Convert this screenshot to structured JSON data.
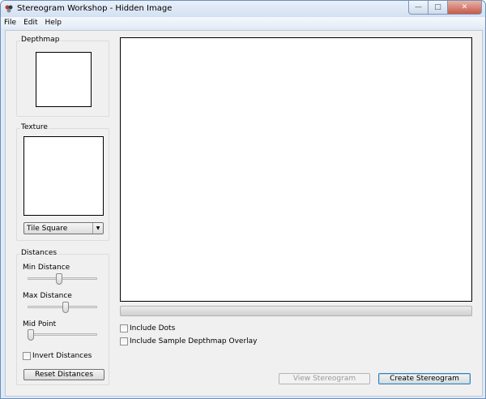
{
  "window": {
    "title": "Stereogram Workshop - Hidden Image",
    "controls": {
      "minimize": "—",
      "maximize": "□",
      "close": "✕"
    }
  },
  "menu": [
    "File",
    "Edit",
    "Help"
  ],
  "depthmap": {
    "label": "Depthmap"
  },
  "texture": {
    "label": "Texture",
    "mode_selected": "Tile Square"
  },
  "distances": {
    "label": "Distances",
    "min": {
      "label": "Min Distance",
      "value_fraction": 0.45
    },
    "max": {
      "label": "Max Distance",
      "value_fraction": 0.55
    },
    "mid": {
      "label": "Mid Point",
      "value_fraction": 0.0
    },
    "invert": {
      "label": "Invert Distances",
      "checked": false
    },
    "reset_label": "Reset Distances"
  },
  "progress": {
    "value_fraction": 0.0
  },
  "options": {
    "include_dots": {
      "label": "Include Dots",
      "checked": false
    },
    "include_overlay": {
      "label": "Include Sample Depthmap Overlay",
      "checked": false
    }
  },
  "actions": {
    "view_label": "View Stereogram",
    "create_label": "Create Stereogram"
  }
}
